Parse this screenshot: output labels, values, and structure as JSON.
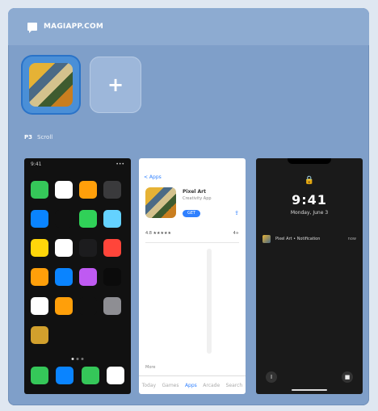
{
  "header": {
    "brand_text": "MAGIAPP.COM",
    "brand_icon": "chat-bubble-icon"
  },
  "tiles": {
    "add_label": "+"
  },
  "caption": {
    "strong": "P3",
    "light": "Scroll"
  },
  "screens": [
    {
      "kind": "home-screen",
      "status_left": "9:41",
      "status_right": "•••",
      "apps": [
        {
          "icon": "phone-icon",
          "color": "#35c759"
        },
        {
          "icon": "calendar-icon",
          "color": "#ffffff"
        },
        {
          "icon": "photos-icon",
          "color": "#ff9f0a"
        },
        {
          "icon": "camera-icon",
          "color": "#3a3a3c"
        },
        {
          "icon": "mail-icon",
          "color": "#0a84ff"
        },
        {
          "icon": "clock-icon",
          "color": "#111111"
        },
        {
          "icon": "maps-icon",
          "color": "#30d158"
        },
        {
          "icon": "weather-icon",
          "color": "#64d2ff"
        },
        {
          "icon": "notes-icon",
          "color": "#ffd60a"
        },
        {
          "icon": "reminders-icon",
          "color": "#ffffff"
        },
        {
          "icon": "stocks-icon",
          "color": "#1c1c1e"
        },
        {
          "icon": "news-icon",
          "color": "#ff453a"
        },
        {
          "icon": "books-icon",
          "color": "#ff9f0a"
        },
        {
          "icon": "appstore-icon",
          "color": "#0a84ff"
        },
        {
          "icon": "podcasts-icon",
          "color": "#bf5af2"
        },
        {
          "icon": "tv-icon",
          "color": "#0b0b0b"
        },
        {
          "icon": "health-icon",
          "color": "#ffffff"
        },
        {
          "icon": "home-icon",
          "color": "#ff9f0a"
        },
        {
          "icon": "wallet-icon",
          "color": "#111111"
        },
        {
          "icon": "settings-icon",
          "color": "#8e8e93"
        },
        {
          "icon": "custom-app-icon",
          "color": "#d2a02d"
        }
      ],
      "dock": [
        {
          "icon": "phone-icon",
          "color": "#35c759"
        },
        {
          "icon": "safari-icon",
          "color": "#0a84ff"
        },
        {
          "icon": "messages-icon",
          "color": "#35c759"
        },
        {
          "icon": "music-icon",
          "color": "#ffffff"
        }
      ]
    },
    {
      "kind": "app-store-listing",
      "back_label": "< Apps",
      "app_title": "Pixel Art",
      "app_subtitle": "Creativity App",
      "get_label": "GET",
      "share_label": "⇪",
      "section_left": "4.8 ★★★★★",
      "section_right": "4+",
      "mini_label": "More",
      "tabs": [
        "Today",
        "Games",
        "Apps",
        "Arcade",
        "Search"
      ]
    },
    {
      "kind": "lock-screen",
      "lock_icon": "lock-icon",
      "time": "9:41",
      "date": "Monday, June 3",
      "notif_text": "Pixel Art • Notification",
      "notif_time": "now",
      "left_button": "flashlight-icon",
      "right_button": "camera-icon",
      "left_glyph": "I",
      "right_glyph": "■"
    }
  ]
}
